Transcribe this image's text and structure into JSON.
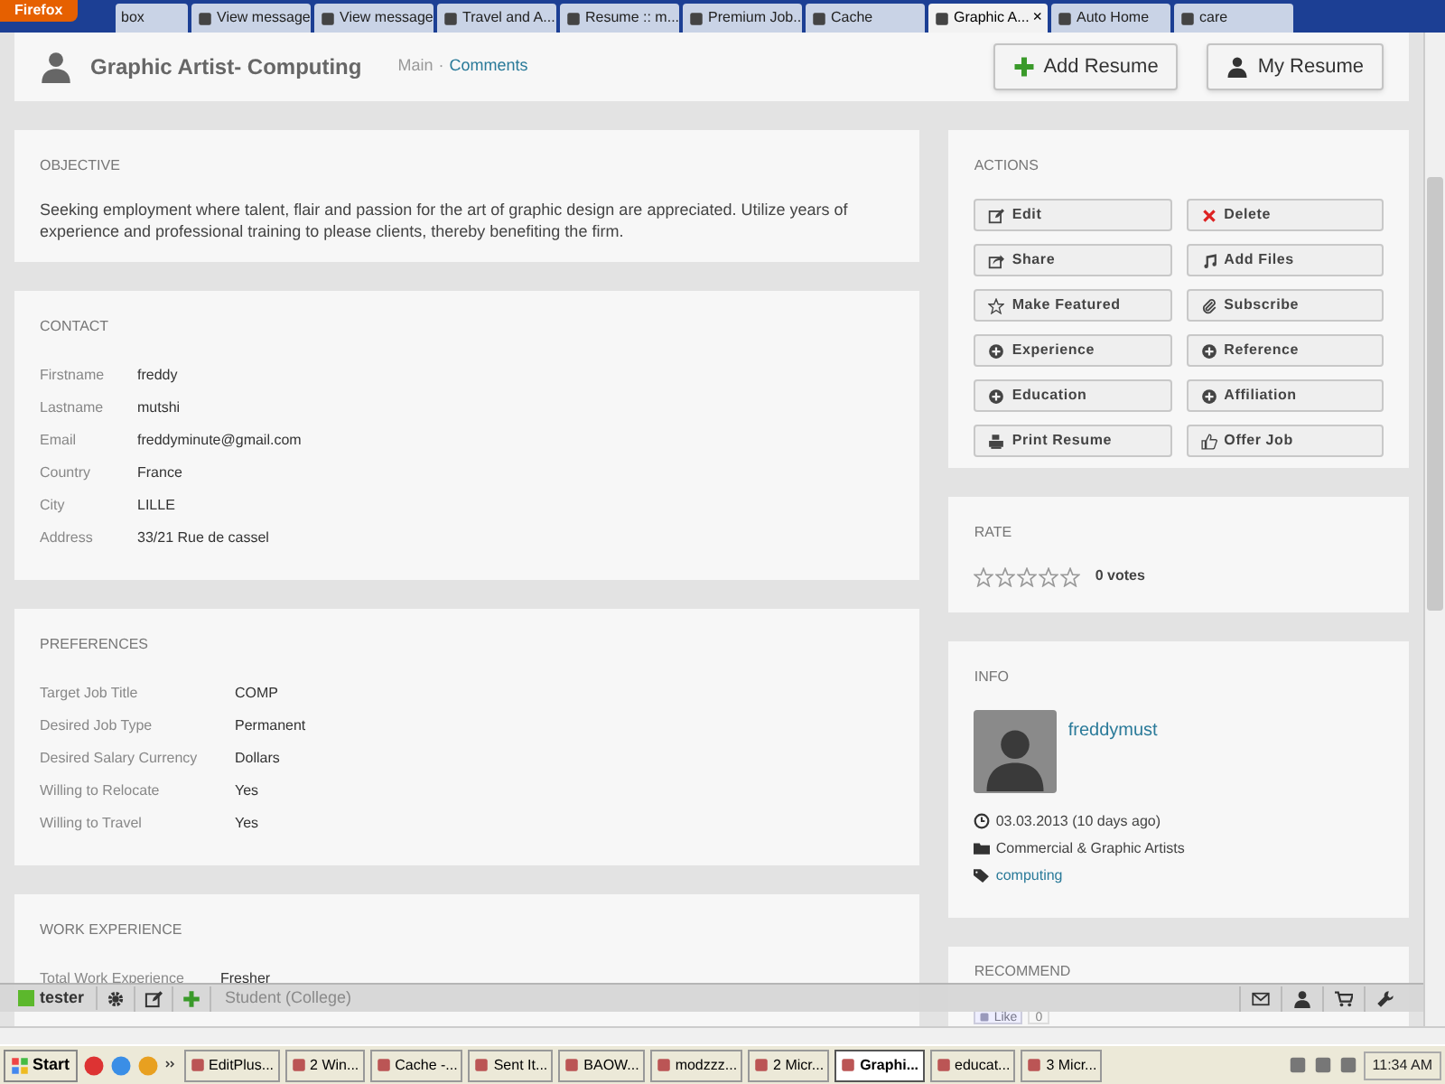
{
  "browser": {
    "menu_button": "Firefox",
    "tabs": [
      {
        "label": "box",
        "selected": false
      },
      {
        "label": "View message",
        "selected": false
      },
      {
        "label": "View message",
        "selected": false
      },
      {
        "label": "Travel and A...",
        "selected": false
      },
      {
        "label": "Resume :: m...",
        "selected": false
      },
      {
        "label": "Premium Job...",
        "selected": false
      },
      {
        "label": "Cache",
        "selected": false
      },
      {
        "label": "Graphic A...",
        "selected": true,
        "close": "×"
      },
      {
        "label": "Auto Home",
        "selected": false
      },
      {
        "label": "care",
        "selected": false
      }
    ]
  },
  "header": {
    "title": "Graphic Artist- Computing",
    "breadcrumb": [
      {
        "label": "Main",
        "link": false
      },
      {
        "label": "·",
        "link": false
      },
      {
        "label": "Comments",
        "link": true
      }
    ],
    "buttons": [
      "Add Resume",
      "My Resume"
    ]
  },
  "objective": {
    "heading": "OBJECTIVE",
    "text": "Seeking employment where talent, flair and passion for the art of graphic design are appreciated. Utilize years of experience and professional training to please clients, thereby benefiting the firm."
  },
  "contact": {
    "heading": "CONTACT",
    "rows": [
      {
        "label": "Firstname",
        "value": "freddy"
      },
      {
        "label": "Lastname",
        "value": "mutshi"
      },
      {
        "label": "Email",
        "value": "freddyminute@gmail.com"
      },
      {
        "label": "Country",
        "value": "France"
      },
      {
        "label": "City",
        "value": "LILLE"
      },
      {
        "label": "Address",
        "value": "33/21 Rue de cassel"
      }
    ]
  },
  "preferences": {
    "heading": "PREFERENCES",
    "rows": [
      {
        "label": "Target Job Title",
        "value": "COMP"
      },
      {
        "label": "Desired Job Type",
        "value": "Permanent"
      },
      {
        "label": "Desired Salary Currency",
        "value": "Dollars"
      },
      {
        "label": "Willing to Relocate",
        "value": "Yes"
      },
      {
        "label": "Willing to Travel",
        "value": "Yes"
      }
    ]
  },
  "work_experience": {
    "heading": "WORK EXPERIENCE",
    "rows": [
      {
        "label": "Total Work Experience",
        "value": "Fresher"
      }
    ]
  },
  "actions": {
    "heading": "ACTIONS",
    "buttons": [
      "Edit",
      "Delete",
      "Share",
      "Add Files",
      "Make Featured",
      "Subscribe",
      "Experience",
      "Reference",
      "Education",
      "Affiliation",
      "Print Resume",
      "Offer Job"
    ]
  },
  "rate": {
    "heading": "RATE",
    "stars": 0,
    "votes": "0 votes"
  },
  "info": {
    "heading": "INFO",
    "username": "freddymust",
    "date": "03.03.2013 (10 days ago)",
    "category": "Commercial & Graphic Artists",
    "tag": "computing"
  },
  "recommend": {
    "heading": "RECOMMEND",
    "like_label": "Like",
    "like_count": "0"
  },
  "toolbar": {
    "user": "tester",
    "status": "Student (College)"
  },
  "taskbar": {
    "start": "Start",
    "items": [
      {
        "label": "EditPlus...",
        "selected": false
      },
      {
        "label": "2 Win...",
        "selected": false
      },
      {
        "label": "Cache -...",
        "selected": false
      },
      {
        "label": "Sent It...",
        "selected": false
      },
      {
        "label": "BAOW...",
        "selected": false
      },
      {
        "label": "modzzz...",
        "selected": false
      },
      {
        "label": "2 Micr...",
        "selected": false
      },
      {
        "label": "Graphi...",
        "selected": true
      },
      {
        "label": "educat...",
        "selected": false
      },
      {
        "label": "3 Micr...",
        "selected": false
      }
    ],
    "clock": "11:34 AM"
  }
}
